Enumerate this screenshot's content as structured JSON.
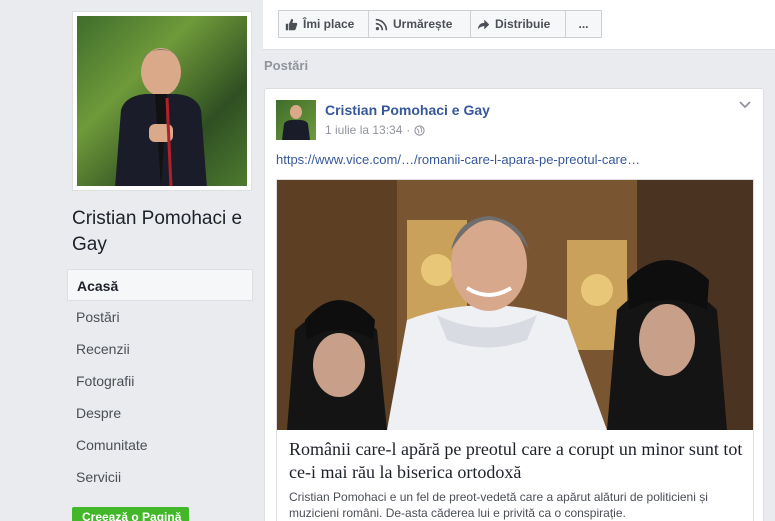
{
  "page": {
    "name": "Cristian Pomohaci e Gay"
  },
  "nav": {
    "items": [
      {
        "label": "Acasă",
        "active": true
      },
      {
        "label": "Postări"
      },
      {
        "label": "Recenzii"
      },
      {
        "label": "Fotografii"
      },
      {
        "label": "Despre"
      },
      {
        "label": "Comunitate"
      },
      {
        "label": "Servicii"
      }
    ],
    "create_page": "Creează o Pagină"
  },
  "action_bar": {
    "like": "Îmi place",
    "follow": "Urmărește",
    "share": "Distribuie",
    "more": "..."
  },
  "section_title": "Postări",
  "post": {
    "author": "Cristian Pomohaci e Gay",
    "time": "1 iulie la 13:34",
    "link_url": "https://www.vice.com/…/romanii-care-l-apara-pe-preotul-care…",
    "link_title": "Românii care-l apără pe preotul care a corupt un minor sunt tot ce-i mai rău la biserica ortodoxă",
    "link_desc": "Cristian Pomohaci e un fel de preot-vedetă care a apărut alături de politicieni și muzicieni români. De-asta căderea lui e privită ca o conspirație."
  },
  "colors": {
    "background": "#e9ebee",
    "link": "#365899",
    "create_button": "#42b72a"
  },
  "icons": [
    "thumbs-up-icon",
    "rss-icon",
    "share-arrow-icon",
    "globe-icon",
    "chevron-down-icon"
  ]
}
